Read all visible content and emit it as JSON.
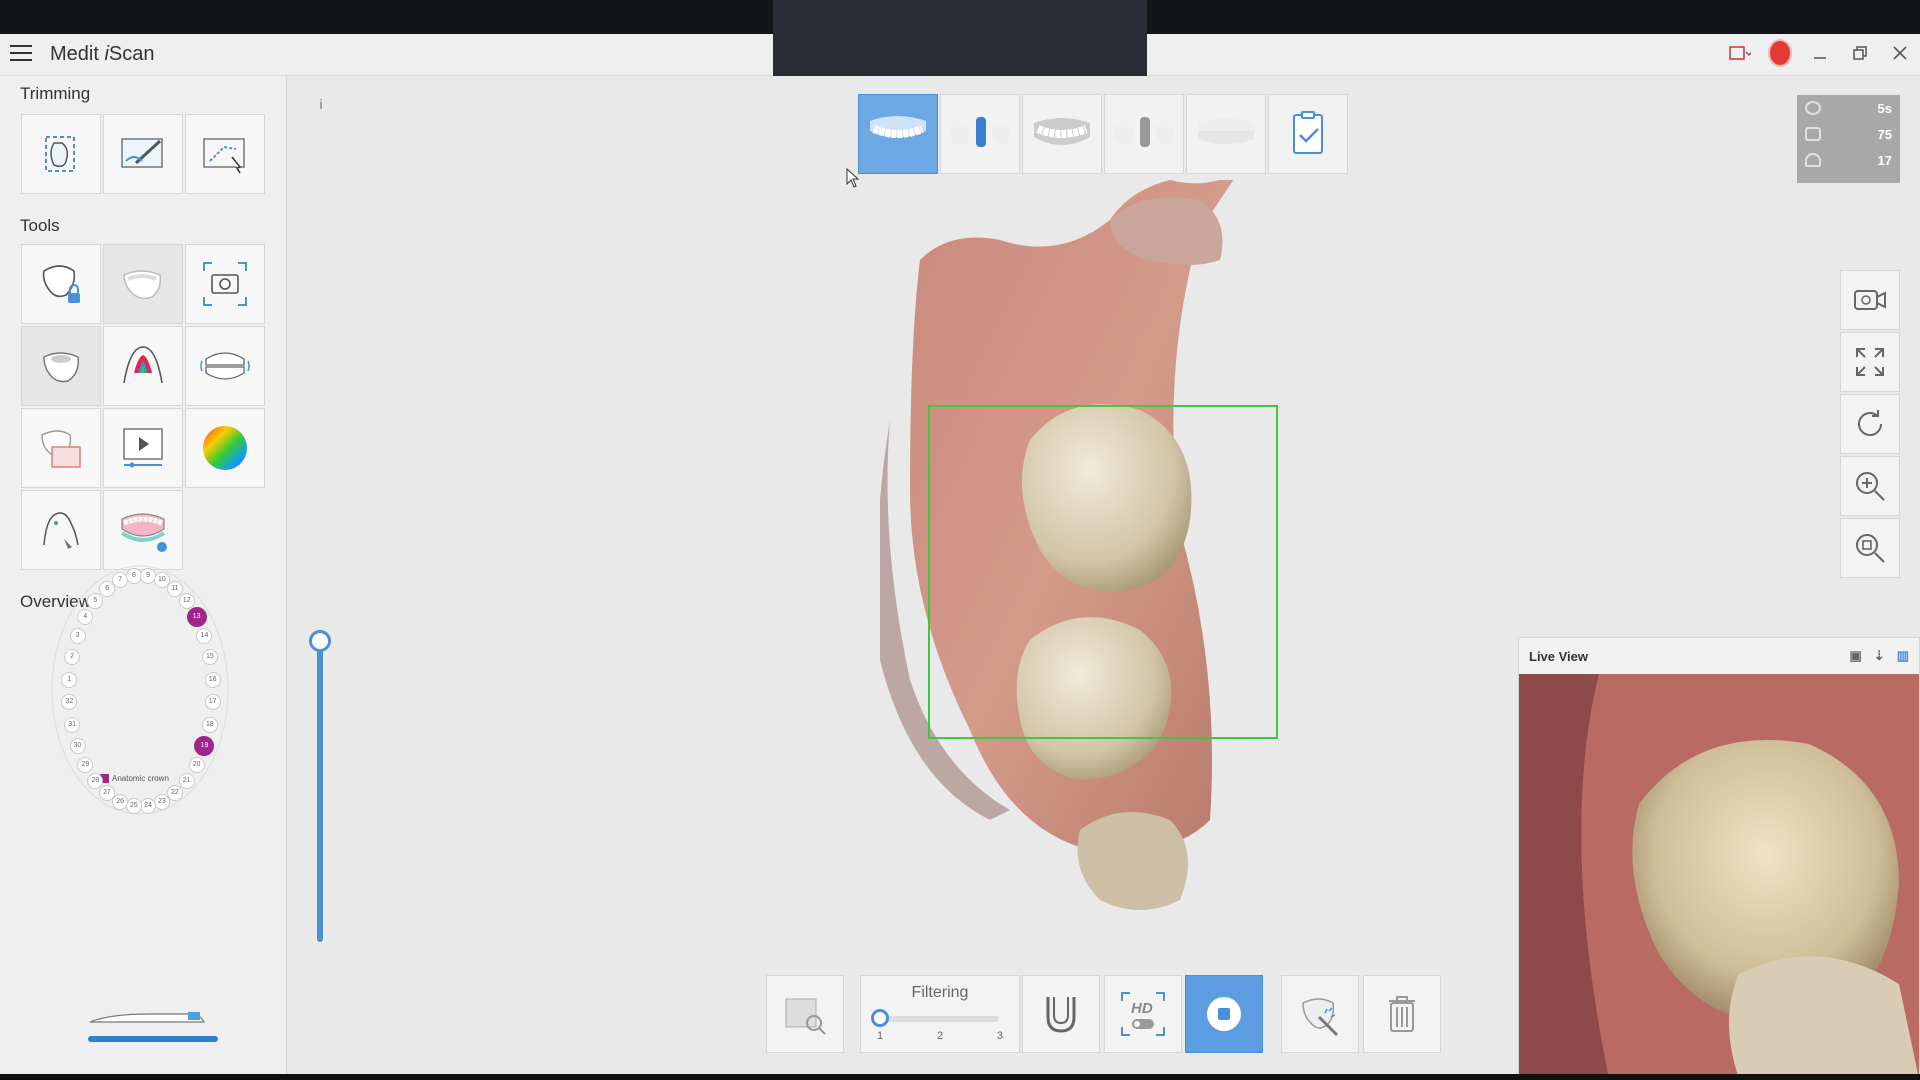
{
  "window": {
    "title_prefix": "Medit ",
    "title_italic": "i",
    "title_suffix": "Scan"
  },
  "sidebar": {
    "trimming_title": "Trimming",
    "tools_title": "Tools",
    "overview_title": "Overview",
    "trimming_tools": [
      {
        "name": "select-area-icon"
      },
      {
        "name": "brush-trim-icon"
      },
      {
        "name": "lasso-trim-icon"
      }
    ],
    "tools": [
      {
        "name": "lock-tooth-icon"
      },
      {
        "name": "tooth-fill-icon"
      },
      {
        "name": "capture-screen-icon"
      },
      {
        "name": "margin-tooth-icon"
      },
      {
        "name": "undercut-icon"
      },
      {
        "name": "occlusion-icon"
      },
      {
        "name": "scan-compare-icon"
      },
      {
        "name": "replay-icon"
      },
      {
        "name": "color-wheel-icon"
      },
      {
        "name": "smart-tips-icon"
      },
      {
        "name": "arch-denture-icon"
      }
    ],
    "overview": {
      "legend": "Anatomic crown",
      "teeth": [
        "1",
        "2",
        "3",
        "4",
        "5",
        "6",
        "7",
        "8",
        "9",
        "10",
        "11",
        "12",
        "13",
        "14",
        "15",
        "16",
        "17",
        "18",
        "19",
        "20",
        "21",
        "22",
        "23",
        "24",
        "25",
        "26",
        "27",
        "28",
        "29",
        "30",
        "31",
        "32"
      ],
      "selected": [
        "13",
        "19"
      ]
    }
  },
  "stage_tabs": [
    {
      "name": "stage-maxilla",
      "active": true
    },
    {
      "name": "stage-maxilla-abutment",
      "active": false
    },
    {
      "name": "stage-mandible",
      "active": false
    },
    {
      "name": "stage-mandible-abutment",
      "active": false
    },
    {
      "name": "stage-occlusion",
      "active": false
    },
    {
      "name": "stage-checklist",
      "active": false
    }
  ],
  "stats": [
    {
      "icon": "timer-icon",
      "value": "5s"
    },
    {
      "icon": "frames-icon",
      "value": "75"
    },
    {
      "icon": "hand-icon",
      "value": "17"
    }
  ],
  "bottom_toolbar": {
    "filtering_label": "Filtering",
    "filtering_ticks": [
      "1",
      "2",
      "3"
    ],
    "filtering_level": 1
  },
  "live_view": {
    "title": "Live View"
  },
  "colors": {
    "accent": "#4a8fd8",
    "selected_tooth": "#a0268c",
    "scan_box": "#3dc83d"
  }
}
